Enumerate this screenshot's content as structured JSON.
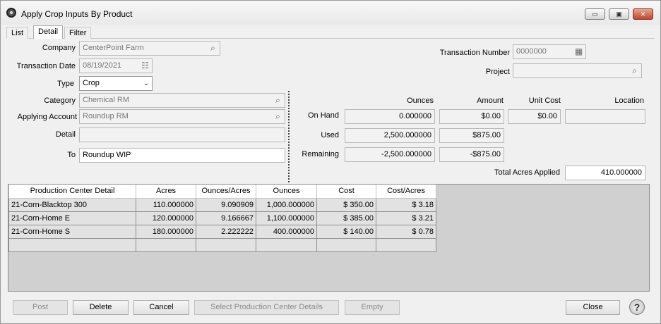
{
  "window": {
    "title": "Apply Crop Inputs By Product"
  },
  "window_controls": {
    "minimize": "▭",
    "restore": "▣",
    "close": "✕"
  },
  "tabs": [
    {
      "label": "List"
    },
    {
      "label": "Detail"
    },
    {
      "label": "Filter"
    }
  ],
  "form": {
    "company_label": "Company",
    "company_value": "CenterPoint Farm",
    "transaction_date_label": "Transaction Date",
    "transaction_date_value": "08/19/2021",
    "type_label": "Type",
    "type_value": "Crop",
    "transaction_number_label": "Transaction Number",
    "transaction_number_value": "0000000",
    "project_label": "Project",
    "project_value": "",
    "category_label": "Category",
    "category_value": "Chemical RM",
    "applying_account_label": "Applying Account",
    "applying_account_value": "Roundup RM",
    "detail_label": "Detail",
    "detail_value": "",
    "to_label": "To",
    "to_value": "Roundup WIP"
  },
  "summary": {
    "headers": {
      "ounces": "Ounces",
      "amount": "Amount",
      "unit_cost": "Unit Cost",
      "location": "Location"
    },
    "on_hand": {
      "label": "On Hand",
      "ounces": "0.000000",
      "amount": "$0.00",
      "unit_cost": "$0.00",
      "location": ""
    },
    "used": {
      "label": "Used",
      "ounces": "2,500.000000",
      "amount": "$875.00"
    },
    "remaining": {
      "label": "Remaining",
      "ounces": "-2,500.000000",
      "amount": "-$875.00"
    },
    "total_acres_label": "Total Acres Applied",
    "total_acres_value": "410.000000"
  },
  "grid": {
    "columns": [
      "Production Center Detail",
      "Acres",
      "Ounces/Acres",
      "Ounces",
      "Cost",
      "Cost/Acres"
    ],
    "rows": [
      [
        "21-Corn-Blacktop 300",
        "110.000000",
        "9.090909",
        "1,000.000000",
        "$ 350.00",
        "$ 3.18"
      ],
      [
        "21-Corn-Home E",
        "120.000000",
        "9.166667",
        "1,100.000000",
        "$ 385.00",
        "$ 3.21"
      ],
      [
        "21-Corn-Home S",
        "180.000000",
        "2.222222",
        "400.000000",
        "$ 140.00",
        "$ 0.78"
      ],
      [
        "",
        "",
        "",
        "",
        "",
        ""
      ]
    ]
  },
  "buttons": {
    "post": "Post",
    "delete": "Delete",
    "cancel": "Cancel",
    "select_pc": "Select Production Center Details",
    "empty": "Empty",
    "close": "Close",
    "help": "?"
  }
}
